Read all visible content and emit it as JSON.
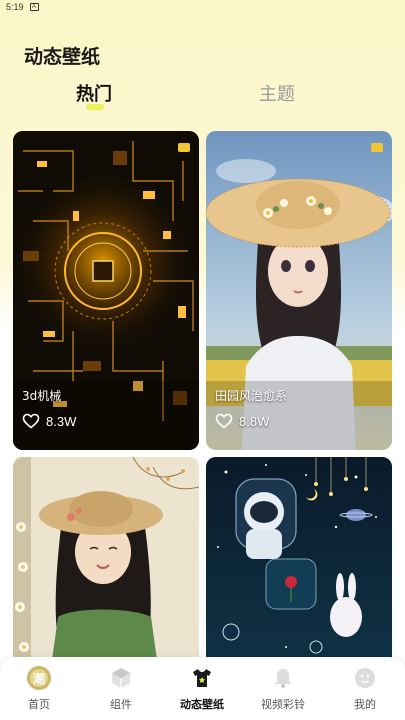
{
  "status": {
    "time": "5:19",
    "notification_glyph": "A"
  },
  "header": {
    "title": "动态壁纸"
  },
  "tabs": [
    {
      "label": "热门",
      "active": true
    },
    {
      "label": "主题",
      "active": false
    }
  ],
  "wallpapers": [
    {
      "title": "3d机械",
      "likes": "8.3W"
    },
    {
      "title": "田园风治愈系",
      "likes": "8.8W"
    },
    {
      "title": "",
      "likes": ""
    },
    {
      "title": "",
      "likes": ""
    }
  ],
  "tabbar": [
    {
      "label": "首页",
      "icon": "home-logo-icon",
      "active": false
    },
    {
      "label": "组件",
      "icon": "cube-icon",
      "active": false
    },
    {
      "label": "动态壁纸",
      "icon": "tshirt-icon",
      "active": true
    },
    {
      "label": "视频彩铃",
      "icon": "bell-icon",
      "active": false
    },
    {
      "label": "我的",
      "icon": "face-icon",
      "active": false
    }
  ],
  "colors": {
    "accent": "#e9f04a",
    "background_top": "#fbf6c8"
  }
}
